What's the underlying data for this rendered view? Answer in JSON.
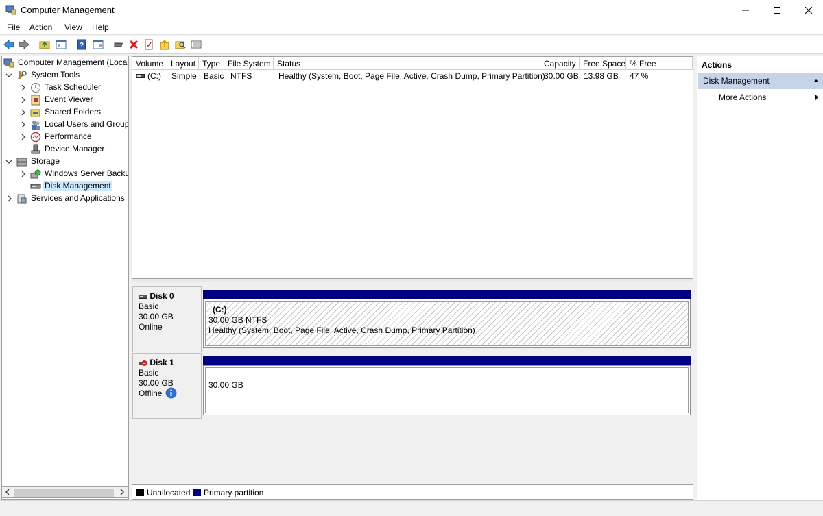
{
  "window": {
    "title": "Computer Management",
    "min_icon": "minimize-icon",
    "max_icon": "maximize-icon",
    "close_icon": "close-icon"
  },
  "menu": [
    "File",
    "Action",
    "View",
    "Help"
  ],
  "tree": [
    {
      "label": "Computer Management (Local",
      "icon": "computer-management-icon",
      "depth": 0,
      "chevron": ""
    },
    {
      "label": "System Tools",
      "icon": "tools-icon",
      "depth": 1,
      "chevron": "expanded"
    },
    {
      "label": "Task Scheduler",
      "icon": "clock-icon",
      "depth": 2,
      "chevron": "collapsed"
    },
    {
      "label": "Event Viewer",
      "icon": "event-viewer-icon",
      "depth": 2,
      "chevron": "collapsed"
    },
    {
      "label": "Shared Folders",
      "icon": "shared-folder-icon",
      "depth": 2,
      "chevron": "collapsed"
    },
    {
      "label": "Local Users and Groups",
      "icon": "users-icon",
      "depth": 2,
      "chevron": "collapsed"
    },
    {
      "label": "Performance",
      "icon": "performance-icon",
      "depth": 2,
      "chevron": "collapsed"
    },
    {
      "label": "Device Manager",
      "icon": "device-manager-icon",
      "depth": 2,
      "chevron": ""
    },
    {
      "label": "Storage",
      "icon": "storage-icon",
      "depth": 1,
      "chevron": "expanded"
    },
    {
      "label": "Windows Server Backup",
      "icon": "backup-icon",
      "depth": 2,
      "chevron": "collapsed"
    },
    {
      "label": "Disk Management",
      "icon": "disk-icon",
      "depth": 2,
      "chevron": "",
      "selected": true
    },
    {
      "label": "Services and Applications",
      "icon": "services-icon",
      "depth": 1,
      "chevron": "collapsed"
    }
  ],
  "volume_list": {
    "columns": [
      "Volume",
      "Layout",
      "Type",
      "File System",
      "Status",
      "Capacity",
      "Free Space",
      "% Free"
    ],
    "rows": [
      {
        "volume": "(C:)",
        "layout": "Simple",
        "type": "Basic",
        "file_system": "NTFS",
        "status": "Healthy (System, Boot, Page File, Active, Crash Dump, Primary Partition)",
        "capacity": "30.00 GB",
        "free_space": "13.98 GB",
        "percent_free": "47 %"
      }
    ]
  },
  "disks": [
    {
      "name": "Disk 0",
      "type": "Basic",
      "size": "30.00 GB",
      "state": "Online",
      "partition": {
        "label": "(C:)",
        "size_fs": "30.00 GB NTFS",
        "status": "Healthy (System, Boot, Page File, Active, Crash Dump, Primary Partition)"
      }
    },
    {
      "name": "Disk 1",
      "type": "Basic",
      "size": "30.00 GB",
      "state": "Offline",
      "partition": {
        "size": "30.00 GB"
      }
    }
  ],
  "legend": [
    {
      "label": "Unallocated",
      "color": "#000000"
    },
    {
      "label": "Primary partition",
      "color": "#000080"
    }
  ],
  "actions": {
    "title": "Actions",
    "section": "Disk Management",
    "item": "More Actions"
  }
}
